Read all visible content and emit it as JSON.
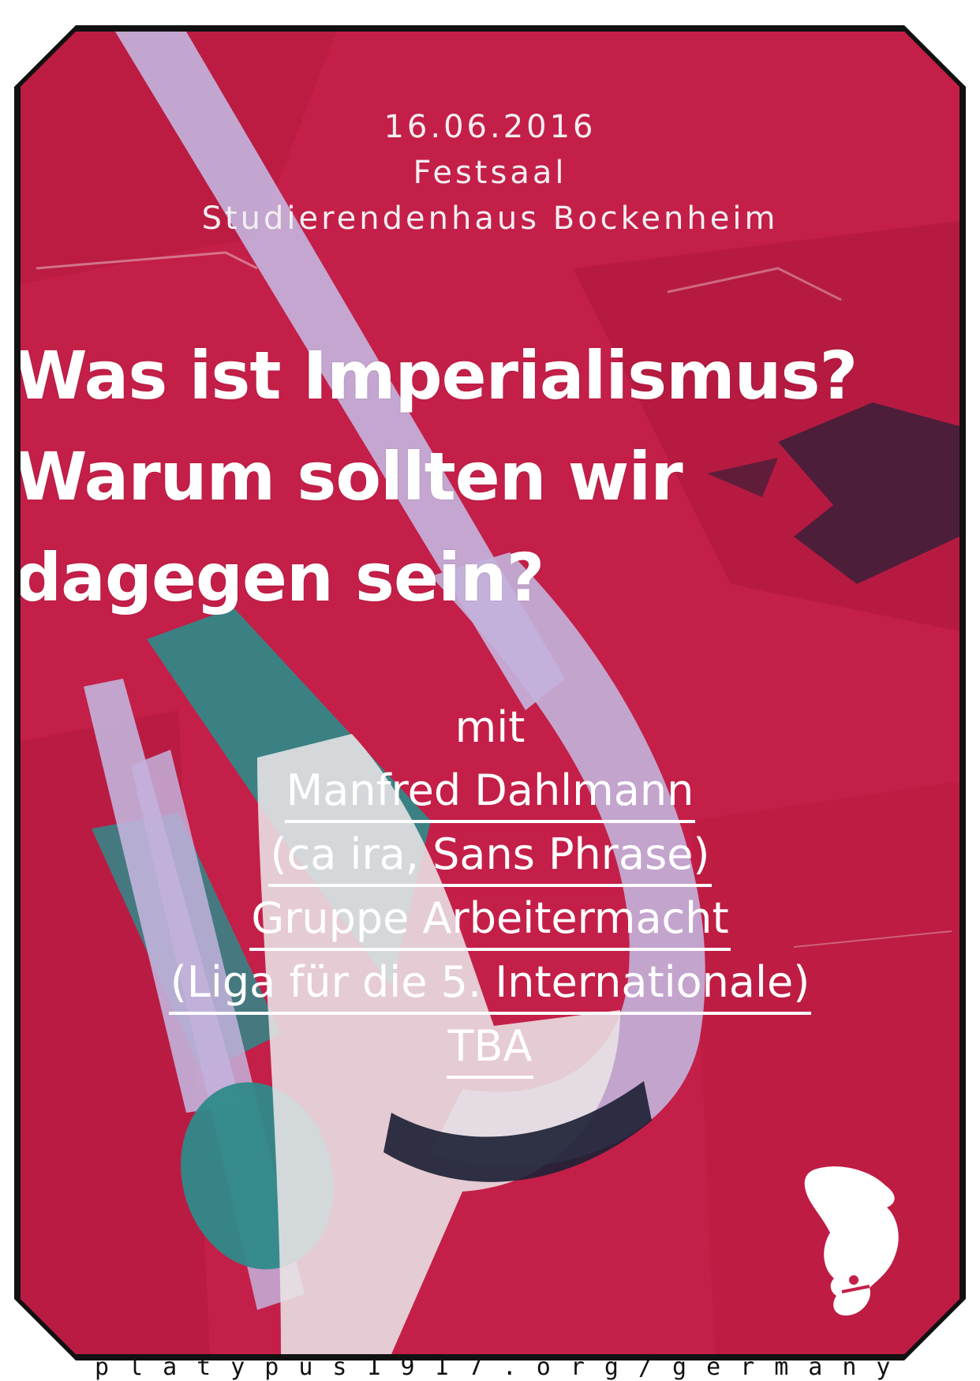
{
  "event": {
    "date": "16.06.2016",
    "venue": "Festsaal",
    "building": "Studierendenhaus Bockenheim"
  },
  "headline": {
    "line1": "Was ist Imperialismus?",
    "line2": "Warum sollten wir",
    "line3": "dagegen sein?"
  },
  "speakers": {
    "intro": "mit",
    "lines": [
      "Manfred Dahlmann",
      "(ca ira, Sans Phrase)",
      "Gruppe Arbeitermacht",
      "(Liga für die 5. Internationale)",
      "TBA"
    ]
  },
  "footer": {
    "url": "platypus1917.org/germany"
  },
  "colors": {
    "poster_red": "#c41f48",
    "lavender": "#c3b2dc",
    "teal": "#2f8a8a",
    "frame": "#111111"
  },
  "logo": {
    "icon": "platypus-icon"
  }
}
